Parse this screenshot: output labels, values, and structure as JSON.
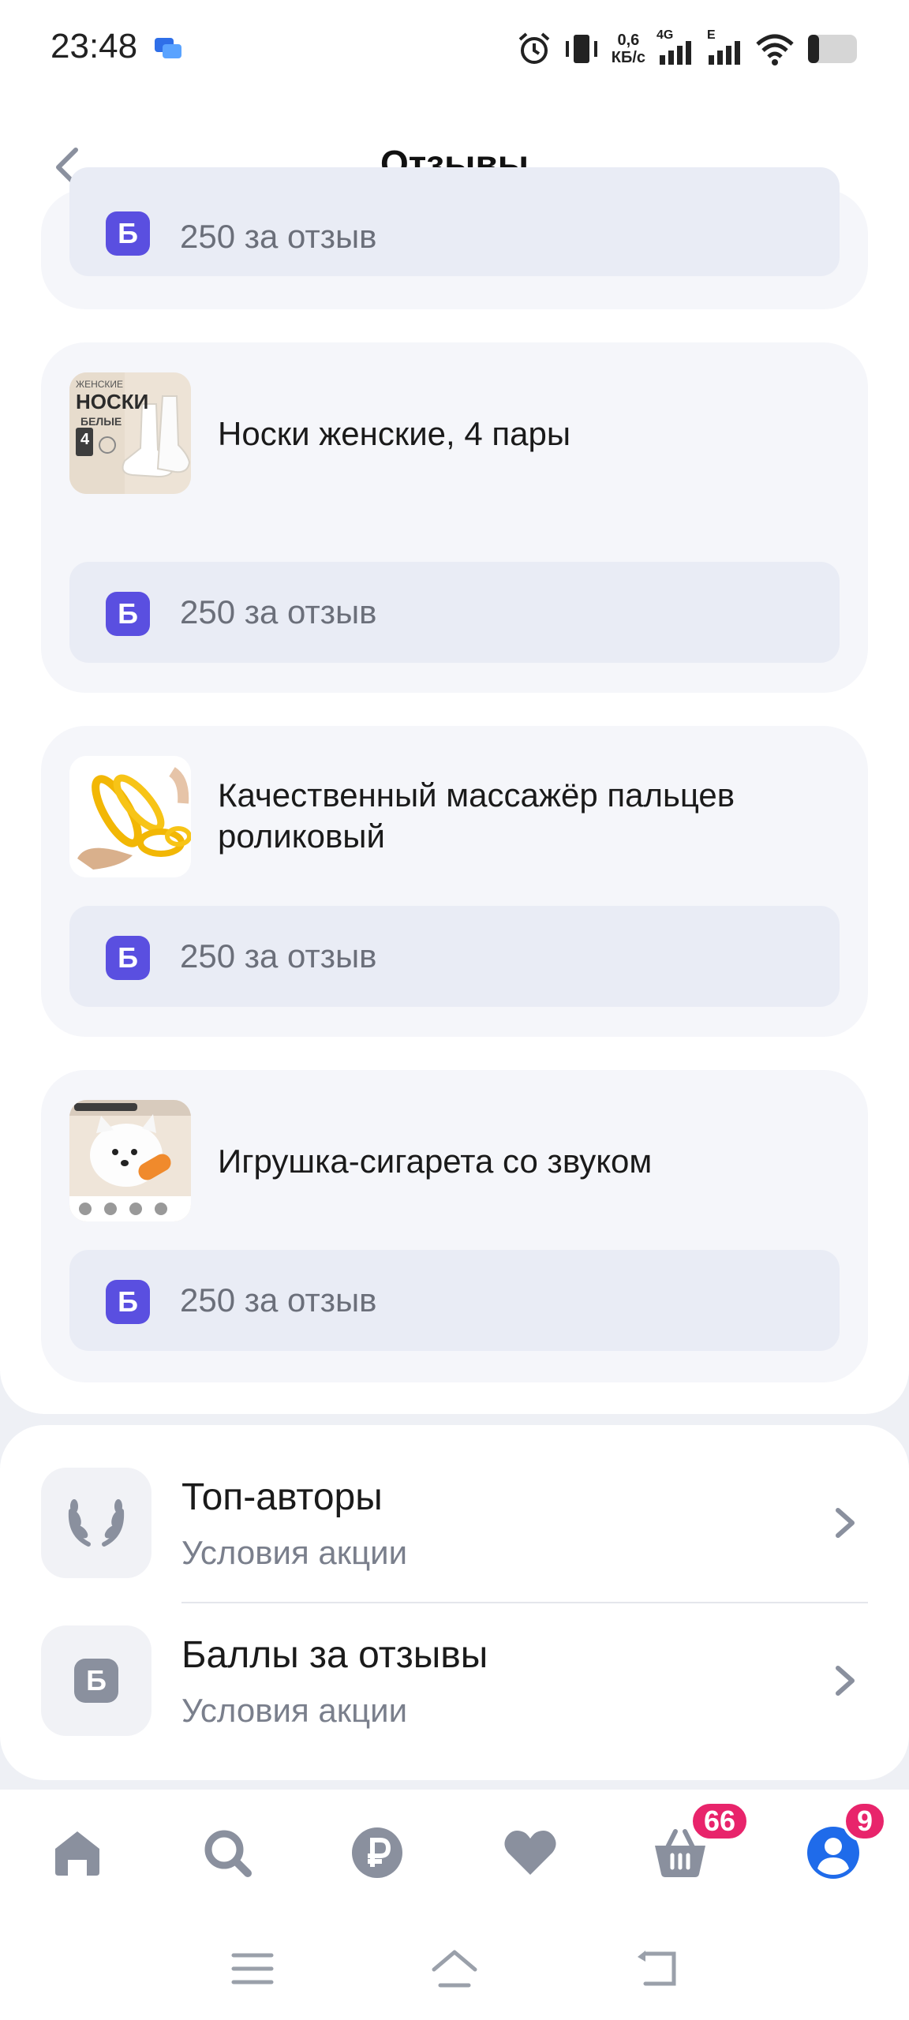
{
  "status_bar": {
    "time": "23:48",
    "net_speed_value": "0,6",
    "net_speed_unit": "КБ/с",
    "net_4g": "4G",
    "net_e": "E"
  },
  "header": {
    "title": "Отзывы"
  },
  "partial_card": {
    "reward_text": "250 за отзыв"
  },
  "products": [
    {
      "name": "Носки женские, 4 пары",
      "reward_icon": "Б",
      "reward_text": "250 за отзыв",
      "image": "socks-photo"
    },
    {
      "name": "Качественный массажёр пальцев роликовый",
      "reward_icon": "Б",
      "reward_text": "250 за отзыв",
      "image": "finger-massager-photo"
    },
    {
      "name": "Игрушка-сигарета со звуком",
      "reward_icon": "Б",
      "reward_text": "250 за отзыв",
      "image": "dog-toy-photo"
    }
  ],
  "thumb_text": {
    "socks_line1": "ЖЕНСКИЕ",
    "socks_line2": "НОСКИ",
    "socks_line3": "БЕЛЫЕ",
    "socks_count": "4"
  },
  "info_items": [
    {
      "title": "Топ-авторы",
      "subtitle": "Условия акции",
      "icon": "laurel-icon"
    },
    {
      "title": "Баллы за отзывы",
      "subtitle": "Условия акции",
      "icon": "points-b-icon",
      "icon_letter": "Б"
    }
  ],
  "nav": {
    "items": [
      "home-icon",
      "search-icon",
      "ruble-icon",
      "heart-icon",
      "basket-icon",
      "profile-icon"
    ],
    "cart_badge": "66",
    "profile_badge": "9"
  },
  "colors": {
    "accent": "#5a4fe0",
    "badge": "#e8246b",
    "profile": "#1f6bea",
    "nav_icon": "#8a909e"
  }
}
